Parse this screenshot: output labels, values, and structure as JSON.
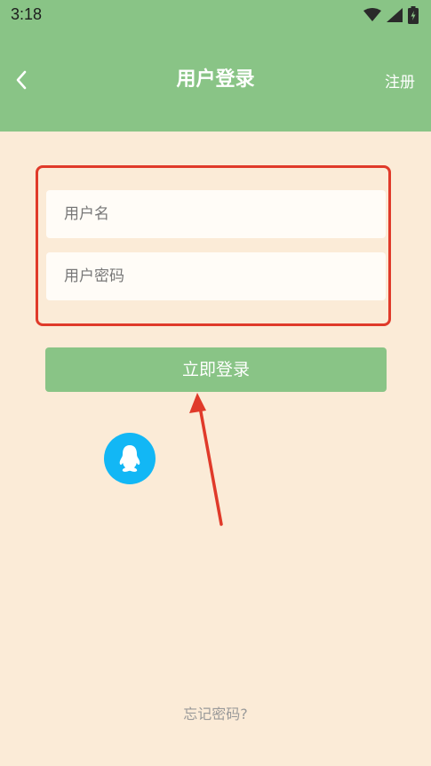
{
  "status_bar": {
    "time": "3:18",
    "icons": [
      "wifi-icon",
      "signal-icon",
      "battery-icon"
    ]
  },
  "nav": {
    "back_icon": "chevron-left-icon",
    "title": "用户登录",
    "register_label": "注册"
  },
  "form": {
    "username_placeholder": "用户名",
    "password_placeholder": "用户密码",
    "login_label": "立即登录",
    "qq_icon": "qq-penguin-icon"
  },
  "footer": {
    "forgot_label": "忘记密码?"
  },
  "colors": {
    "header": "#89c486",
    "background": "#fbebd7",
    "highlight_border": "#e03a2a",
    "qq_blue": "#12b7f5"
  }
}
